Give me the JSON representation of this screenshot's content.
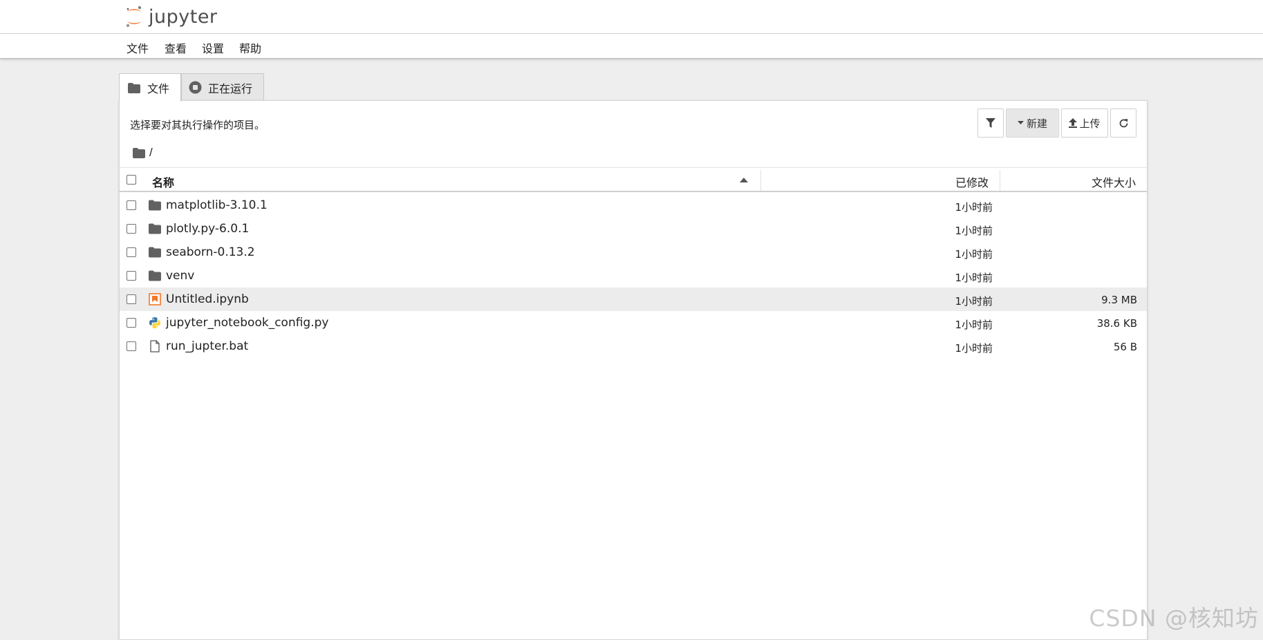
{
  "app": {
    "logo_text": "jupyter"
  },
  "menu": {
    "items": [
      {
        "label": "文件"
      },
      {
        "label": "查看"
      },
      {
        "label": "设置"
      },
      {
        "label": "帮助"
      }
    ]
  },
  "tabs": [
    {
      "label": "文件",
      "icon": "folder-icon",
      "active": true
    },
    {
      "label": "正在运行",
      "icon": "stop-circle-icon",
      "active": false
    }
  ],
  "panel": {
    "hint": "选择要对其执行操作的项目。",
    "toolbar": {
      "filter_icon": "filter-icon",
      "new_label": "新建",
      "upload_label": "上传",
      "refresh_icon": "refresh-icon"
    },
    "breadcrumb": "/",
    "columns": {
      "name": "名称",
      "modified": "已修改",
      "size": "文件大小"
    },
    "files": [
      {
        "name": "matplotlib-3.10.1",
        "type": "folder",
        "modified": "1小时前",
        "size": ""
      },
      {
        "name": "plotly.py-6.0.1",
        "type": "folder",
        "modified": "1小时前",
        "size": ""
      },
      {
        "name": "seaborn-0.13.2",
        "type": "folder",
        "modified": "1小时前",
        "size": ""
      },
      {
        "name": "venv",
        "type": "folder",
        "modified": "1小时前",
        "size": ""
      },
      {
        "name": "Untitled.ipynb",
        "type": "notebook",
        "modified": "1小时前",
        "size": "9.3 MB",
        "highlighted": true
      },
      {
        "name": "jupyter_notebook_config.py",
        "type": "python",
        "modified": "1小时前",
        "size": "38.6 KB"
      },
      {
        "name": "run_jupter.bat",
        "type": "file",
        "modified": "1小时前",
        "size": "56 B"
      }
    ]
  },
  "watermark": "CSDN @核知坊",
  "colors": {
    "jupyter_orange": "#f37726",
    "folder_gray": "#616161",
    "highlight_row": "#ececec"
  }
}
